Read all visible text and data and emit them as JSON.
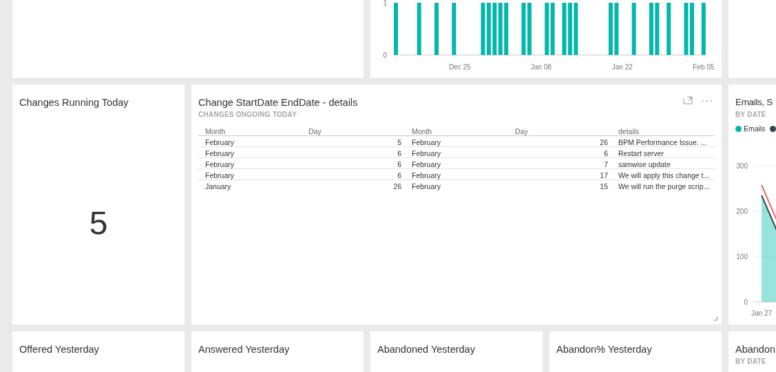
{
  "top_row": {
    "bar_chart": {
      "chart_data": {
        "type": "bar",
        "categories": [
          null,
          null,
          null,
          null,
          null,
          null,
          null,
          null,
          null,
          null,
          null,
          "Dec 25",
          null,
          null,
          null,
          null,
          null,
          null,
          null,
          null,
          null,
          null,
          null,
          null,
          null,
          "Jan 08",
          null,
          null,
          null,
          null,
          null,
          null,
          null,
          null,
          null,
          null,
          null,
          null,
          null,
          "Jan 22",
          null,
          null,
          null,
          null,
          null,
          null,
          null,
          null,
          null,
          null,
          null,
          null,
          null,
          "Feb 05"
        ],
        "series": [
          {
            "color": "#01b8aa",
            "values": [
              1,
              0,
              0,
              0,
              1,
              0,
              0,
              1,
              0,
              0,
              1,
              0,
              0,
              0,
              0,
              1,
              1,
              1,
              1,
              1,
              0,
              0,
              1,
              1,
              0,
              0,
              1,
              1,
              0,
              1,
              1,
              1,
              0,
              0,
              0,
              0,
              0,
              1,
              1,
              0,
              0,
              1,
              0,
              0,
              1,
              1,
              0,
              1,
              0,
              0,
              1,
              1,
              0,
              1
            ]
          }
        ],
        "ylim": [
          0,
          1
        ],
        "yticks": [
          0,
          1
        ]
      }
    }
  },
  "card": {
    "title": "Changes Running Today",
    "value": "5"
  },
  "table_tile": {
    "title": "Change StartDate EndDate - details",
    "subtitle": "CHANGES ONGOING TODAY",
    "columns": [
      "Month",
      "Day",
      "Month",
      "Day",
      "details"
    ],
    "rows": [
      [
        "February",
        "5",
        "February",
        "26",
        "BPM Performance Issue. ..."
      ],
      [
        "February",
        "6",
        "February",
        "6",
        "Restart server"
      ],
      [
        "February",
        "6",
        "February",
        "7",
        "samwise update"
      ],
      [
        "February",
        "6",
        "February",
        "17",
        "We will apply this change t..."
      ],
      [
        "January",
        "26",
        "February",
        "15",
        "We will run the purge scrip..."
      ]
    ]
  },
  "emails_tile": {
    "title": "Emails, S",
    "subtitle": "BY DATE",
    "legend": [
      {
        "label": "Emails",
        "color": "#01b8aa"
      },
      {
        "color": "#374649"
      }
    ],
    "y_axis_labels": [
      "300",
      "200",
      "100",
      "0"
    ],
    "x_axis_labels": [
      "Jan 27"
    ]
  },
  "bottom_row": [
    {
      "title": "Offered Yesterday"
    },
    {
      "title": "Answered Yesterday"
    },
    {
      "title": "Abandoned Yesterday"
    },
    {
      "title": "Abandon% Yesterday"
    },
    {
      "title": "Abandon",
      "subtitle": "BY DATE"
    }
  ]
}
